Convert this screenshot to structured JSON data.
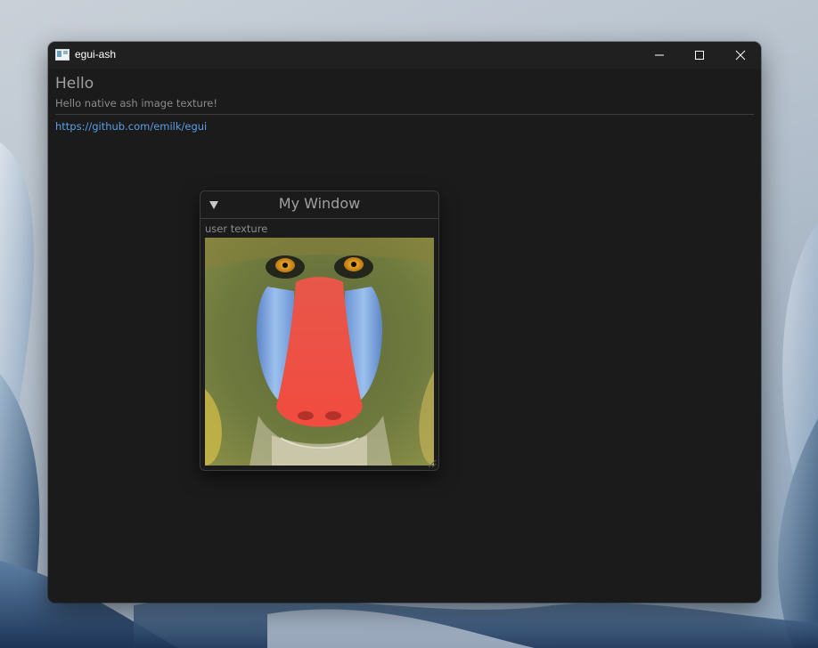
{
  "window": {
    "title": "egui-ash",
    "icon": "app-icon",
    "controls": [
      "minimize-icon",
      "maximize-icon",
      "close-icon"
    ]
  },
  "main": {
    "heading": "Hello",
    "subtext": "Hello native ash image texture!",
    "link": "https://github.com/emilk/egui"
  },
  "float_window": {
    "title": "My Window",
    "collapse_icon": "triangle-down-icon",
    "label": "user texture",
    "image": "mandrill-texture-image"
  },
  "colors": {
    "window_bg": "#1b1b1b",
    "titlebar_bg": "#202020",
    "text": "#a0a0a0",
    "link": "#5a9ee6",
    "border": "#3c3c3c"
  }
}
